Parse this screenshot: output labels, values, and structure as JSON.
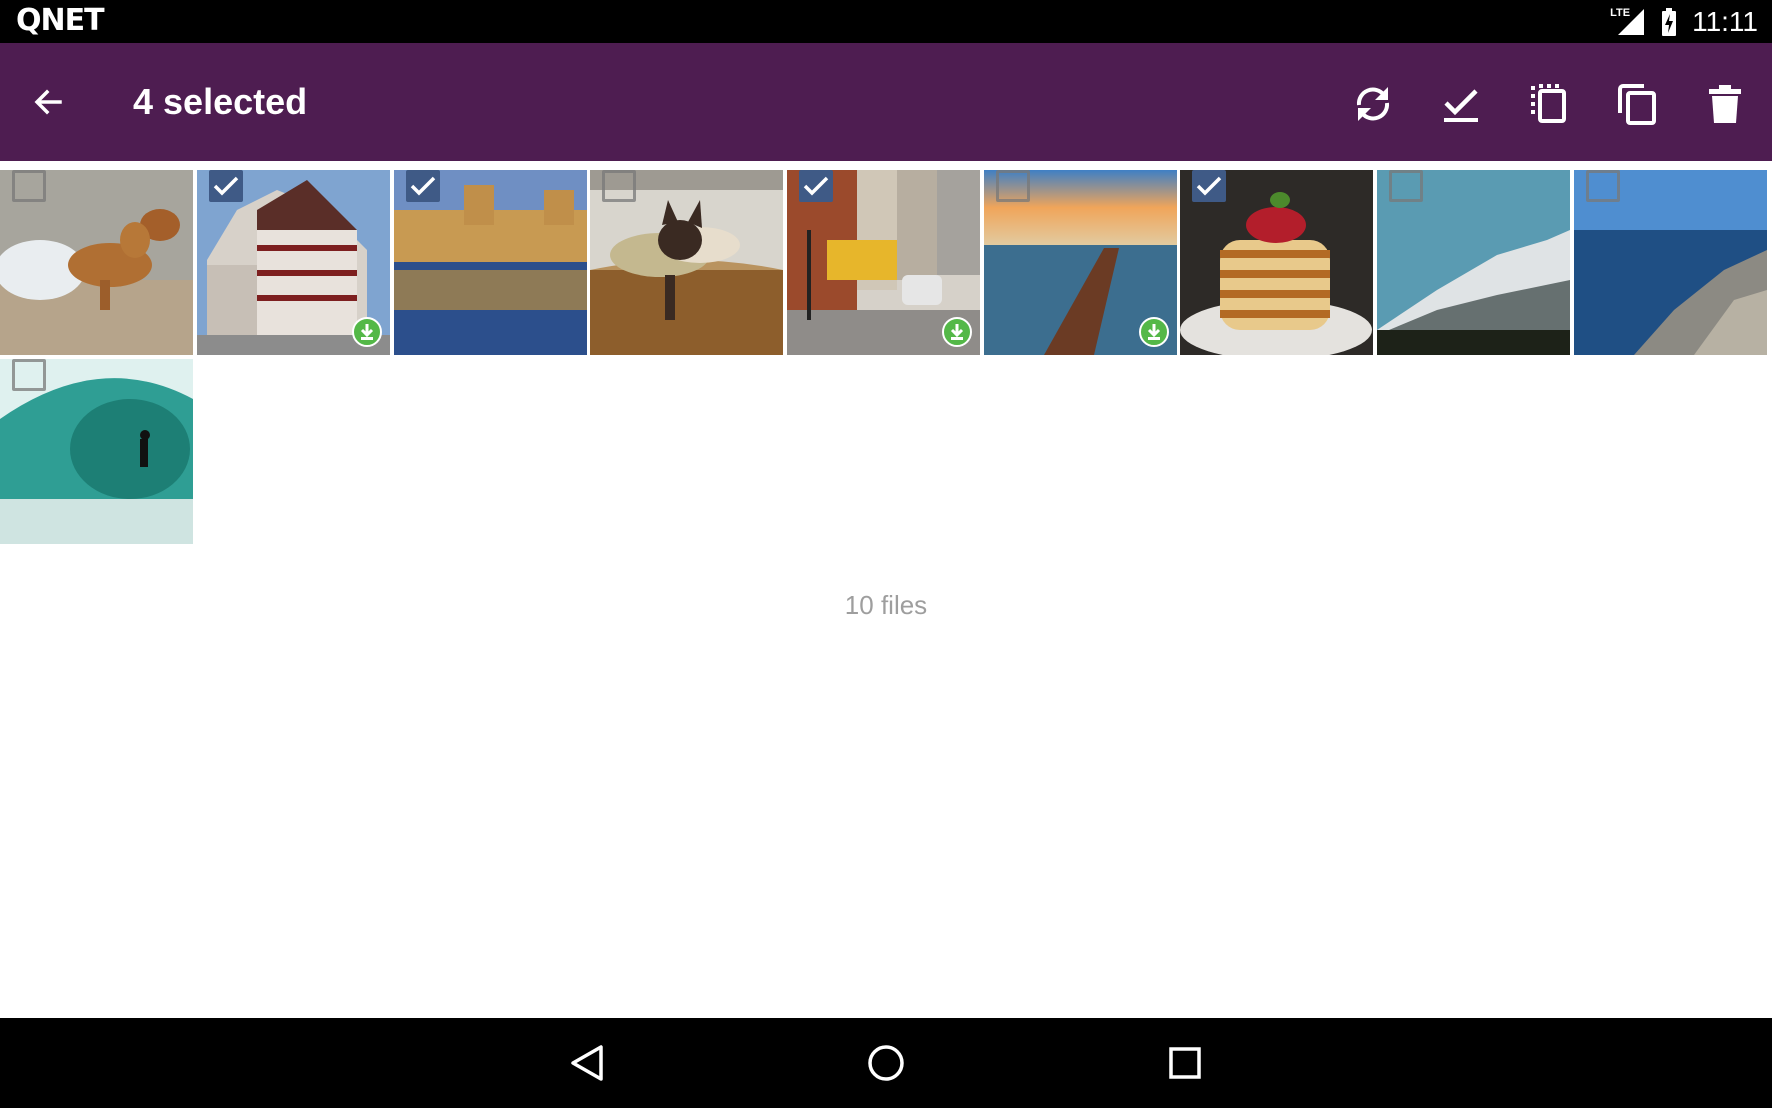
{
  "status_bar": {
    "logo": "QNET",
    "network_label": "LTE",
    "time": "11:11"
  },
  "toolbar": {
    "title": "4 selected",
    "background_color": "#4e1d51",
    "actions": [
      {
        "name": "sync",
        "icon": "sync-icon"
      },
      {
        "name": "select-all",
        "icon": "select-all-check-icon"
      },
      {
        "name": "move",
        "icon": "move-icon"
      },
      {
        "name": "copy",
        "icon": "copy-icon"
      },
      {
        "name": "delete",
        "icon": "trash-icon"
      }
    ]
  },
  "grid": {
    "items": [
      {
        "subject": "dog running in water",
        "selected": false,
        "downloaded": false
      },
      {
        "subject": "half-timbered house",
        "selected": true,
        "downloaded": true
      },
      {
        "subject": "palace reflected in water",
        "selected": true,
        "downloaded": false
      },
      {
        "subject": "siamese cat",
        "selected": false,
        "downloaded": false
      },
      {
        "subject": "city street",
        "selected": true,
        "downloaded": true
      },
      {
        "subject": "pier at sunset",
        "selected": false,
        "downloaded": true
      },
      {
        "subject": "stack of pancakes",
        "selected": true,
        "downloaded": false
      },
      {
        "subject": "snowy mountain",
        "selected": false,
        "downloaded": false
      },
      {
        "subject": "rocky coast",
        "selected": false,
        "downloaded": false
      },
      {
        "subject": "surfer in wave",
        "selected": false,
        "downloaded": false
      }
    ],
    "file_count": "10 files"
  },
  "nav_bar": {
    "buttons": [
      "back",
      "home",
      "recents"
    ]
  }
}
